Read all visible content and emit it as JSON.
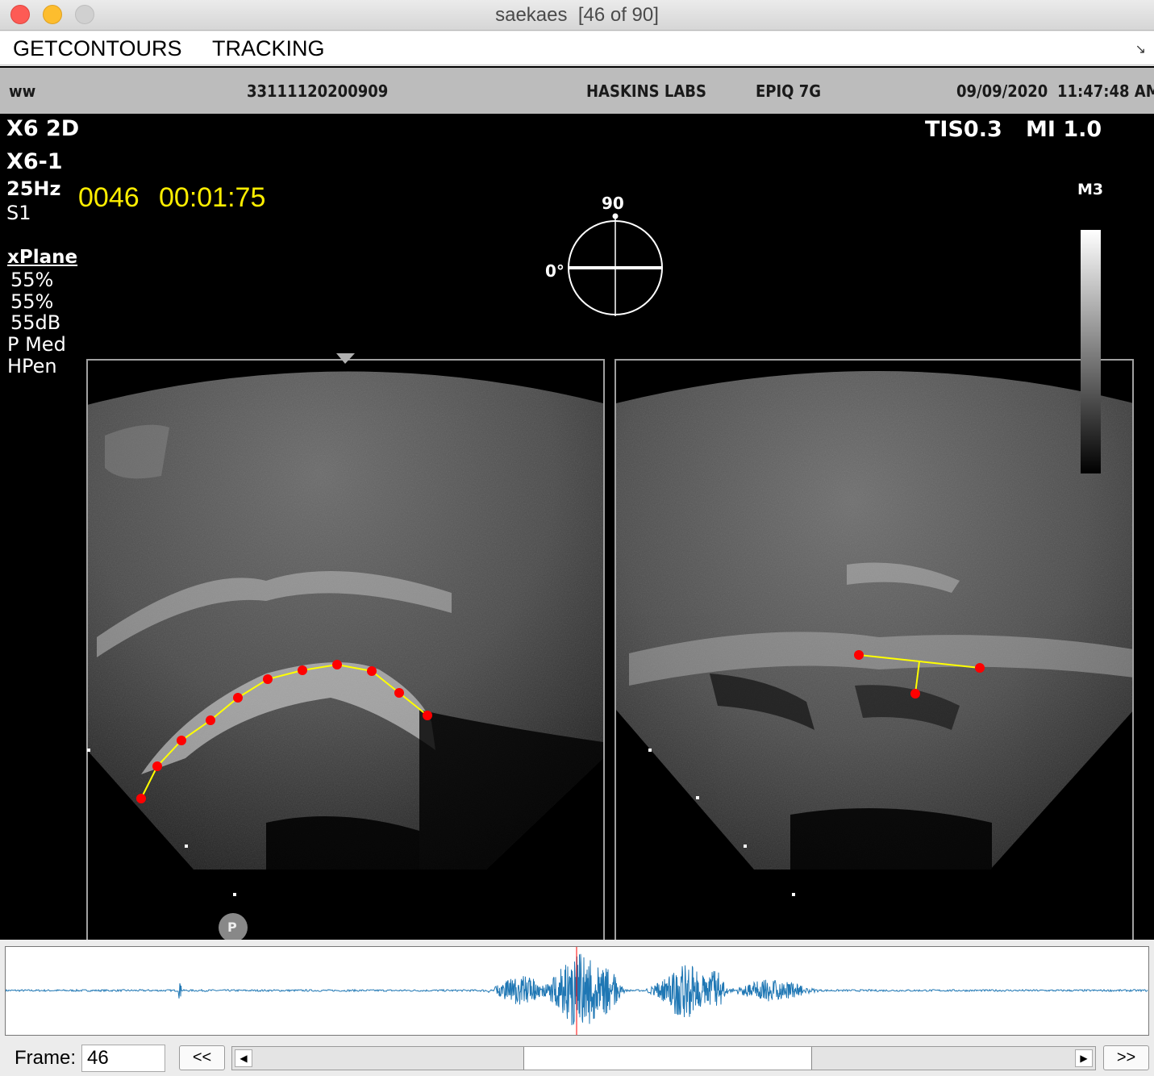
{
  "window": {
    "title": "saekaes  [46 of 90]"
  },
  "menu": {
    "items": [
      "GETCONTOURS",
      "TRACKING"
    ]
  },
  "header": {
    "operator": "ww",
    "patient_id": "33111120200909",
    "institution": "HASKINS LABS",
    "system": "EPIQ 7G",
    "date": "09/09/2020",
    "time": "11:47:48 AM"
  },
  "overlay": {
    "mode": "X6 2D",
    "probe": "X6-1",
    "rate": "25Hz",
    "preset": "S1",
    "frame_counter": "0046",
    "timecode": "00:01:75",
    "tis": "TIS0.3",
    "mi": "MI 1.0",
    "map": "M3",
    "angle_top": "90",
    "angle_left": "0°",
    "xplane_label": "xPlane",
    "params": [
      "55%",
      "55%",
      "55dB",
      "P Med",
      "HPen"
    ],
    "p_marker": "P"
  },
  "contour_points": {
    "left_panel_count": 11,
    "right_panel_count": 3
  },
  "controls": {
    "frame_label": "Frame:",
    "frame_value": "46",
    "prev_label": "<<",
    "next_label": ">>",
    "slider_left_arrow": "◀",
    "slider_right_arrow": "▶",
    "current_frame": 46,
    "total_frames": 90
  },
  "colors": {
    "contour_line": "#ffff00",
    "contour_point": "#ff0000",
    "waveform": "#1f77b4",
    "cursor": "#ff0000",
    "overlay_time": "#ffee00"
  }
}
